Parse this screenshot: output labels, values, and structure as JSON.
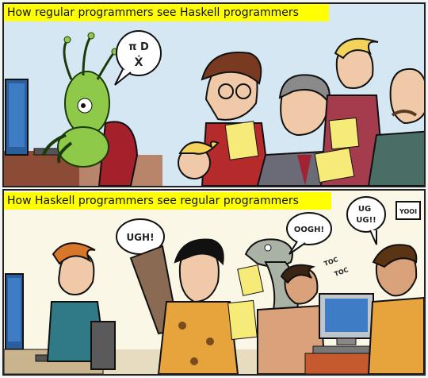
{
  "panels": {
    "top": {
      "caption": "How regular programmers see Haskell programmers",
      "bubble": {
        "line1": "π D",
        "line2": "Ẋ"
      }
    },
    "bottom": {
      "caption": "How Haskell programmers see regular programmers",
      "bubbles": {
        "ugh": "UGH!",
        "oogh": "OOGH!",
        "ug1": "UG",
        "ug2": "UG!!",
        "sign": "YOOI",
        "toc1": "TOC",
        "toc2": "TOC"
      }
    }
  },
  "colors": {
    "caption_bg": "#ffff00",
    "alien_green": "#8fc94a",
    "monitor_blue": "#3e7cc6"
  }
}
